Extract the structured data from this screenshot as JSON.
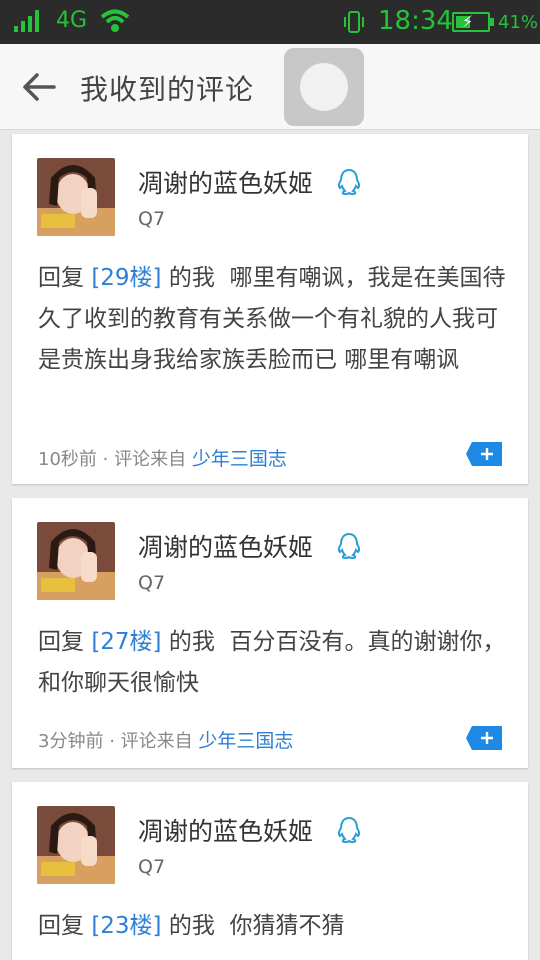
{
  "status_bar": {
    "network": "4G",
    "time": "18:34",
    "battery": "41%"
  },
  "header": {
    "title": "我收到的评论"
  },
  "colors": {
    "accent": "#2d7fd6",
    "status_green": "#25c23a"
  },
  "comments": [
    {
      "username": "凋谢的蓝色妖姬",
      "device": "Q7",
      "reply_prefix": "回复",
      "floor": "[29楼]",
      "reply_suffix": "的我",
      "body": "哪里有嘲讽，我是在美国待久了收到的教育有关系做一个有礼貌的人我可是贵族出身我给家族丢脸而已 哪里有嘲讽",
      "time": "10秒前",
      "source_label": "· 评论来自",
      "source": "少年三国志"
    },
    {
      "username": "凋谢的蓝色妖姬",
      "device": "Q7",
      "reply_prefix": "回复",
      "floor": "[27楼]",
      "reply_suffix": "的我",
      "body": "百分百没有。真的谢谢你，和你聊天很愉快",
      "time": "3分钟前",
      "source_label": "· 评论来自",
      "source": "少年三国志"
    },
    {
      "username": "凋谢的蓝色妖姬",
      "device": "Q7",
      "reply_prefix": "回复",
      "floor": "[23楼]",
      "reply_suffix": "的我",
      "body": "你猜猜不猜"
    }
  ]
}
